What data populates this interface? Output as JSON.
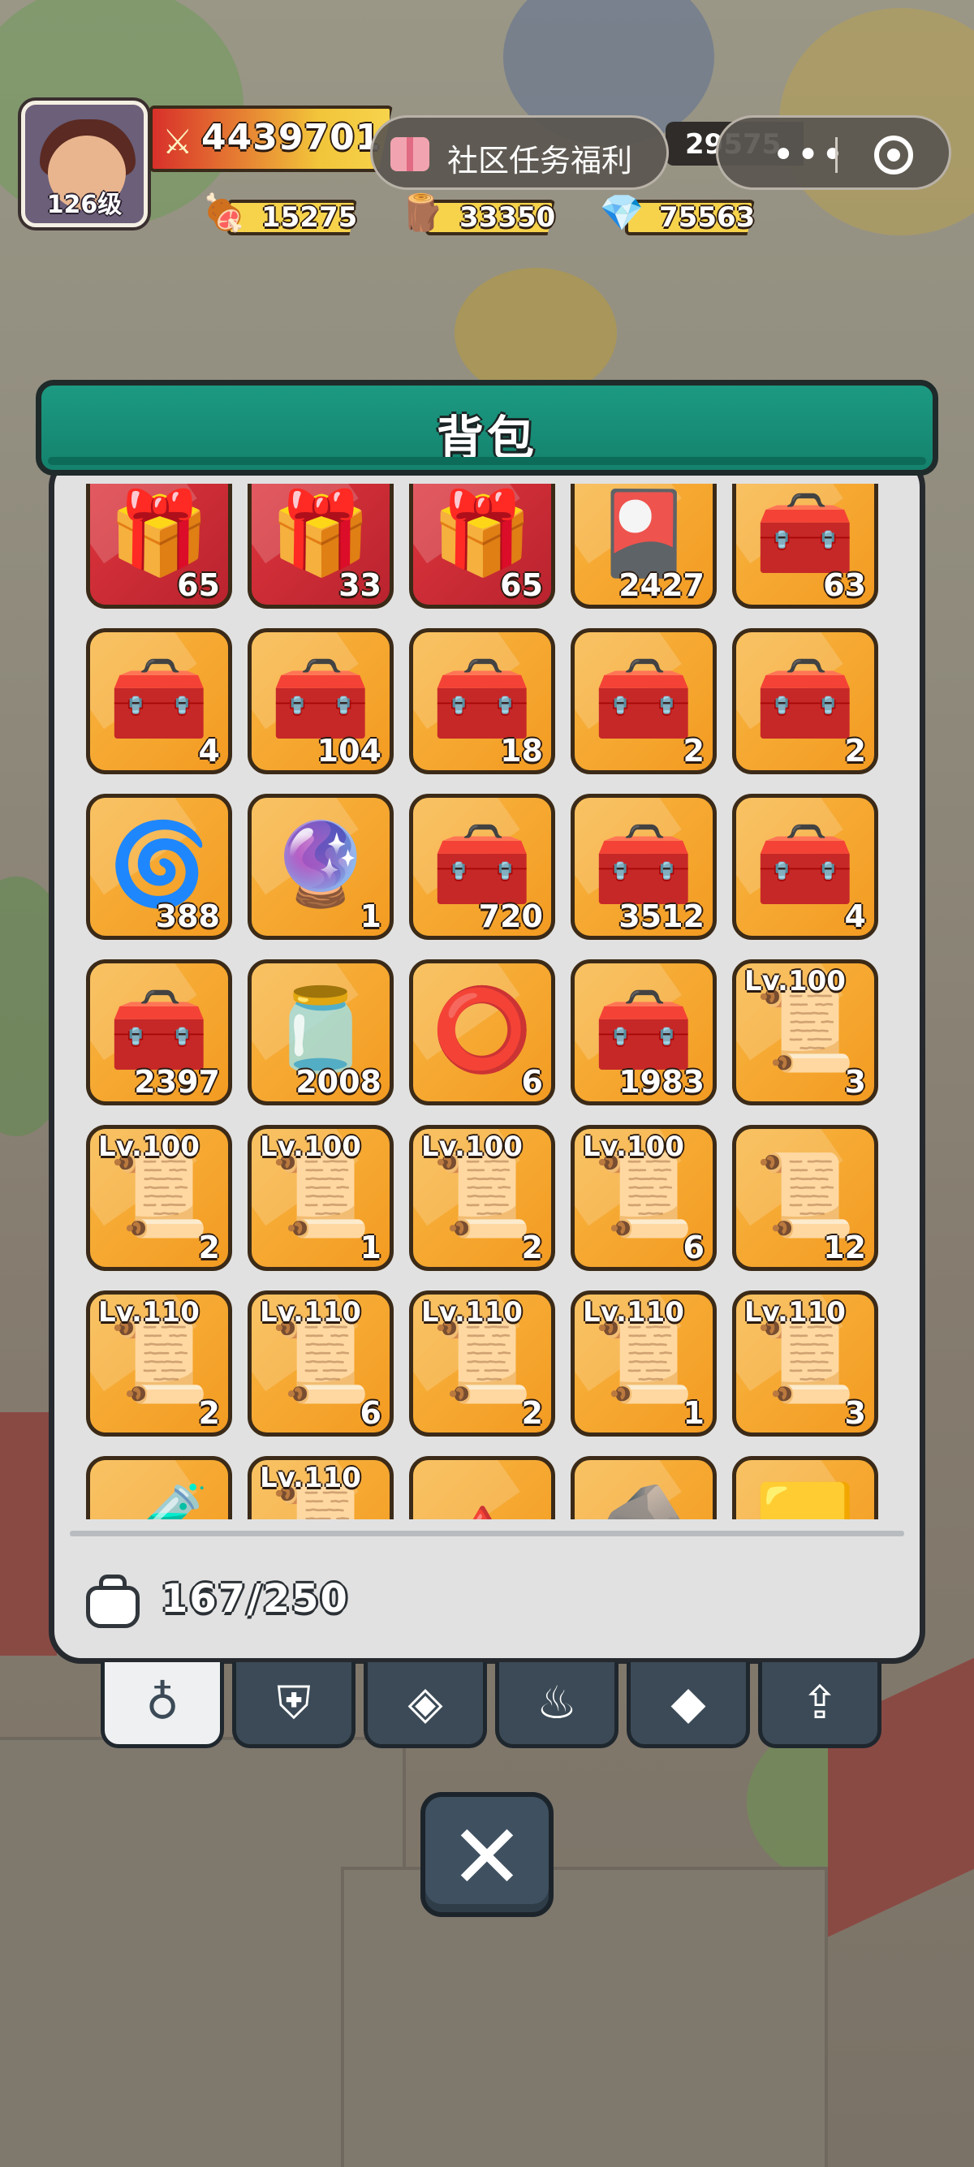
{
  "player": {
    "level_label": "126级",
    "power": "4439701",
    "gold": "29575"
  },
  "resources": [
    {
      "name": "meat",
      "icon": "🍖",
      "value": "15275"
    },
    {
      "name": "wood",
      "icon": "🪵",
      "value": "33350"
    },
    {
      "name": "gem",
      "icon": "💎",
      "value": "75563"
    }
  ],
  "community_button": "社区任务福利",
  "capsule": {
    "more": "•••"
  },
  "backpack": {
    "title": "背包",
    "capacity": "167/250",
    "items": [
      {
        "icon": "🎁",
        "bg": "red",
        "lv": "",
        "count": "65"
      },
      {
        "icon": "🎁",
        "bg": "red",
        "lv": "",
        "count": "33"
      },
      {
        "icon": "🎁",
        "bg": "red",
        "lv": "",
        "count": "65"
      },
      {
        "icon": "🎴",
        "bg": "gold",
        "lv": "",
        "count": "2427"
      },
      {
        "icon": "🧰",
        "bg": "gold",
        "lv": "",
        "count": "63"
      },
      {
        "icon": "🧰",
        "bg": "gold",
        "lv": "",
        "count": "4"
      },
      {
        "icon": "🧰",
        "bg": "gold",
        "lv": "",
        "count": "104"
      },
      {
        "icon": "🧰",
        "bg": "gold",
        "lv": "",
        "count": "18"
      },
      {
        "icon": "🧰",
        "bg": "gold",
        "lv": "",
        "count": "2"
      },
      {
        "icon": "🧰",
        "bg": "gold",
        "lv": "",
        "count": "2"
      },
      {
        "icon": "🌀",
        "bg": "gold",
        "lv": "",
        "count": "388"
      },
      {
        "icon": "🔮",
        "bg": "gold",
        "lv": "",
        "count": "1"
      },
      {
        "icon": "🧰",
        "bg": "gold",
        "lv": "",
        "count": "720"
      },
      {
        "icon": "🧰",
        "bg": "gold",
        "lv": "",
        "count": "3512"
      },
      {
        "icon": "🧰",
        "bg": "gold",
        "lv": "",
        "count": "4"
      },
      {
        "icon": "🧰",
        "bg": "gold",
        "lv": "",
        "count": "2397"
      },
      {
        "icon": "🫙",
        "bg": "gold",
        "lv": "",
        "count": "2008"
      },
      {
        "icon": "⭕",
        "bg": "gold",
        "lv": "",
        "count": "6"
      },
      {
        "icon": "🧰",
        "bg": "gold",
        "lv": "",
        "count": "1983"
      },
      {
        "icon": "📜",
        "bg": "gold",
        "lv": "Lv.100",
        "count": "3"
      },
      {
        "icon": "📜",
        "bg": "gold",
        "lv": "Lv.100",
        "count": "2"
      },
      {
        "icon": "📜",
        "bg": "gold",
        "lv": "Lv.100",
        "count": "1"
      },
      {
        "icon": "📜",
        "bg": "gold",
        "lv": "Lv.100",
        "count": "2"
      },
      {
        "icon": "📜",
        "bg": "gold",
        "lv": "Lv.100",
        "count": "6"
      },
      {
        "icon": "📜",
        "bg": "gold",
        "lv": "",
        "count": "12"
      },
      {
        "icon": "📜",
        "bg": "gold",
        "lv": "Lv.110",
        "count": "2"
      },
      {
        "icon": "📜",
        "bg": "gold",
        "lv": "Lv.110",
        "count": "6"
      },
      {
        "icon": "📜",
        "bg": "gold",
        "lv": "Lv.110",
        "count": "2"
      },
      {
        "icon": "📜",
        "bg": "gold",
        "lv": "Lv.110",
        "count": "1"
      },
      {
        "icon": "📜",
        "bg": "gold",
        "lv": "Lv.110",
        "count": "3"
      },
      {
        "icon": "🧪",
        "bg": "gold",
        "lv": "",
        "count": ""
      },
      {
        "icon": "📜",
        "bg": "gold",
        "lv": "Lv.110",
        "count": ""
      },
      {
        "icon": "🔺",
        "bg": "gold",
        "lv": "",
        "count": ""
      },
      {
        "icon": "🪨",
        "bg": "gold",
        "lv": "",
        "count": ""
      },
      {
        "icon": "🟨",
        "bg": "gold",
        "lv": "",
        "count": ""
      }
    ]
  },
  "tabs": [
    {
      "name": "bag",
      "glyph": "♁",
      "active": true
    },
    {
      "name": "armor",
      "glyph": "⛨",
      "active": false
    },
    {
      "name": "shard",
      "glyph": "◈",
      "active": false
    },
    {
      "name": "fire",
      "glyph": "♨",
      "active": false
    },
    {
      "name": "diamond",
      "glyph": "◆",
      "active": false
    },
    {
      "name": "upgrade",
      "glyph": "⇪",
      "active": false
    }
  ],
  "close_glyph": "✕"
}
